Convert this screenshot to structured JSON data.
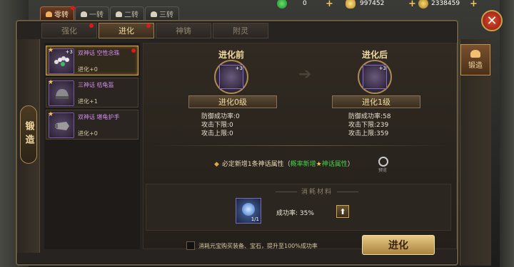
{
  "currency": {
    "jade": "0",
    "gold": "997452",
    "coin": "2338459"
  },
  "rebirth_tabs": [
    "零转",
    "一转",
    "二转",
    "三转"
  ],
  "sub_tabs": [
    "强化",
    "进化",
    "神铸",
    "附灵"
  ],
  "side_left_label": "锻造",
  "side_right_label": "锻造",
  "items": [
    {
      "name": "双神话 空性念珠",
      "sub": "进化+0",
      "level": "+3"
    },
    {
      "name": "三神话 桔龟盔",
      "sub": "进化+1",
      "level": ""
    },
    {
      "name": "双神话 堪龟护手",
      "sub": "进化+0",
      "level": ""
    }
  ],
  "before": {
    "title": "进化前",
    "level": "+3",
    "plaque": "进化0级",
    "stats": [
      "防御成功率:0",
      "攻击下限:0",
      "攻击上限:0"
    ]
  },
  "after": {
    "title": "进化后",
    "level": "+3",
    "plaque": "进化1级",
    "stats": [
      "防御成功率:58",
      "攻击下限:239",
      "攻击上限:359"
    ]
  },
  "notice": {
    "main": "必定新增1条神话属性（",
    "green1": "概率新增",
    "star": "★",
    "green2": "神话属性",
    "end": "）"
  },
  "preview_label": "预览",
  "materials": {
    "title": "消耗材料",
    "count": "1/1",
    "rate": "成功率: 35%"
  },
  "checkbox_label": "消耗元宝购买装备、宝石，提升至100%成功率",
  "evolve_button": "进化"
}
